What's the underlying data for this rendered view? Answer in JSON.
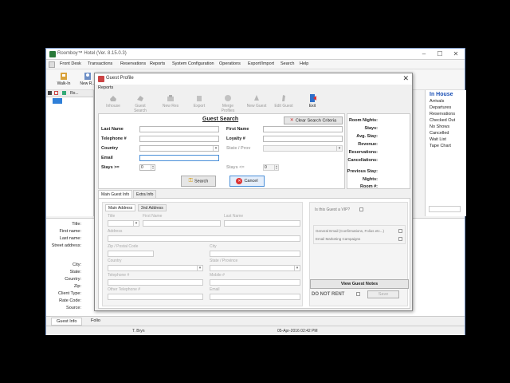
{
  "main_window": {
    "title": "Roomboy™ Hotel (Ver. 8.15.0.3)",
    "controls": [
      "–",
      "☐",
      "✕"
    ],
    "menu": [
      "Front Desk",
      "Transactions",
      "Reservations",
      "Reports",
      "System Configuration",
      "Operations",
      "Export/Import",
      "Search",
      "Help"
    ],
    "toolbar": [
      {
        "label": "Walk-In",
        "icon": "walk-in-icon"
      },
      {
        "label": "New R...",
        "icon": "new-reservation-icon"
      }
    ],
    "grid_header": [
      "Ro..."
    ],
    "in_house": {
      "title": "In House",
      "items": [
        "Arrivals",
        "Departures",
        "Reservations",
        "Checked Out",
        "No Shows",
        "Cancelled",
        "Wait List",
        "Tape Chart"
      ]
    },
    "details": {
      "labels": [
        "Title:",
        "First name:",
        "Last name:",
        "Street address:",
        "City:",
        "State:",
        "Country:",
        "Zip:",
        "Client Type:",
        "Rate Code:",
        "Source:"
      ]
    },
    "bottom_tabs": [
      "Guest Info",
      "Folio"
    ],
    "status": {
      "user": "T. Bryn",
      "datetime": "05-Apr-2016 02:42 PM"
    }
  },
  "dialog": {
    "title": "Guest Profile",
    "close": "✕",
    "menu": "Reports",
    "toolbar": [
      {
        "label": "Inhouse",
        "icon": "inhouse-icon",
        "enabled": false
      },
      {
        "label": "Guest Search",
        "icon": "guest-search-icon",
        "enabled": false
      },
      {
        "label": "New Res",
        "icon": "new-res-icon",
        "enabled": false
      },
      {
        "label": "Export",
        "icon": "export-icon",
        "enabled": false
      },
      {
        "label": "Merge Profiles",
        "icon": "merge-profiles-icon",
        "enabled": false
      },
      {
        "label": "New Guest",
        "icon": "new-guest-icon",
        "enabled": false
      },
      {
        "label": "Edit Guest",
        "icon": "edit-guest-icon",
        "enabled": false
      },
      {
        "label": "Exit",
        "icon": "exit-icon",
        "enabled": true
      }
    ],
    "search": {
      "title": "Guest Search",
      "clear_label": "Clear Search Criteria",
      "last_name": "Last Name",
      "first_name": "First Name",
      "telephone": "Telephone #",
      "loyalty": "Loyalty #",
      "country": "Country",
      "state": "State / Prov",
      "email": "Email",
      "stays_gte": "Stays >=",
      "stays_lte": "Stays <=",
      "stays_gte_value": "0",
      "stays_lte_value": "0",
      "search_label": "Search",
      "cancel_label": "Cancel"
    },
    "stats": [
      "Room Nights:",
      "Stays:",
      "Avg. Stay:",
      "Revenue:",
      "Reservations:",
      "Cancellations:",
      "Previous Stay:",
      "Nights:",
      "Room #:"
    ],
    "tabs": [
      "Main Guest Info",
      "Extra Info"
    ],
    "address": {
      "subtabs": [
        "Main Address",
        "2nd Address"
      ],
      "title": "Title",
      "first_name": "First Name",
      "last_name": "Last Name",
      "address": "Address",
      "zip": "Zip / Postal Code",
      "city": "City",
      "country": "Country",
      "state": "State / Province",
      "telephone": "Telephone #",
      "mobile": "Mobile #",
      "other_telephone": "Other Telephone #",
      "email": "Email"
    },
    "vip": {
      "question": "Is this Guest a VIP?",
      "general_email": "General Email (Confirmations, Folios etc...)",
      "marketing": "Email Marketing Campaigns",
      "view_notes": "View Guest Notes",
      "do_not_rent": "DO NOT RENT",
      "save": "Save"
    }
  }
}
